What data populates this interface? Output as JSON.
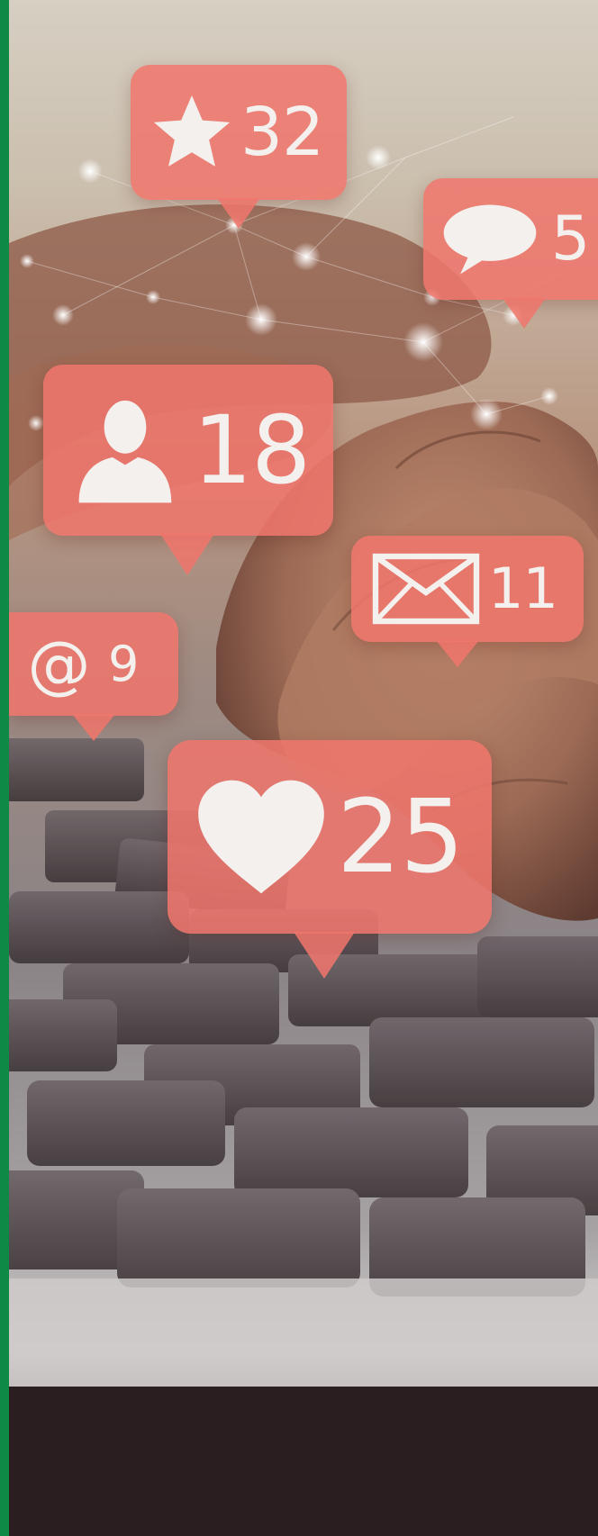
{
  "colors": {
    "accent_strip": "#0f8a45",
    "badge": "#f0766c",
    "badge_text": "#f4f0ee"
  },
  "badges": [
    {
      "icon": "star-icon",
      "count": "32"
    },
    {
      "icon": "speech-bubble-icon",
      "count": "5"
    },
    {
      "icon": "user-icon",
      "count": "18"
    },
    {
      "icon": "envelope-icon",
      "count": "11"
    },
    {
      "icon": "at-sign-icon",
      "count": "9"
    },
    {
      "icon": "heart-icon",
      "count": "25"
    }
  ]
}
